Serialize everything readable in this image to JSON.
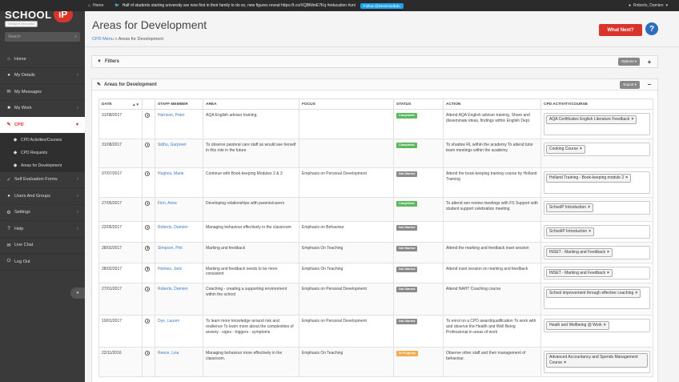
{
  "topbar": {
    "home": "Home",
    "tweet": "Half of students starting university are now first in their family to do so, new figures reveal https://t.co/XQBNlmE7Kq #education #uni",
    "follow": "Follow @DeveniodEdu",
    "user": "Roberts, Damien"
  },
  "logo": {
    "name": "SCHOOL",
    "ip": "iP",
    "tagline": "Intelligent Information"
  },
  "search": {
    "placeholder": "Search"
  },
  "nav": [
    {
      "label": "Home",
      "icon": "home-icon"
    },
    {
      "label": "My Details",
      "icon": "user-icon"
    },
    {
      "label": "My Messages",
      "icon": "envelope-icon"
    },
    {
      "label": "My Work",
      "icon": "briefcase-icon"
    }
  ],
  "cpd": {
    "label": "CPD",
    "sub": [
      {
        "label": "CPD Activities/Courses"
      },
      {
        "label": "CPD Requests"
      },
      {
        "label": "Areas for Development"
      }
    ]
  },
  "nav2": [
    {
      "label": "Self Evaluation Forms"
    },
    {
      "label": "Users And Groups"
    },
    {
      "label": "Settings"
    },
    {
      "label": "Help"
    },
    {
      "label": "Live Chat"
    },
    {
      "label": "Log Out"
    }
  ],
  "page": {
    "title": "Areas for Development",
    "crumb_link": "CPD Menu",
    "crumb_rest": " » Areas for Development",
    "what_next": "What Next?",
    "help": "?"
  },
  "filters": {
    "title": "Filters",
    "options_button": "Options ▾",
    "toggle": "+"
  },
  "areas": {
    "title": "Areas for Development",
    "export_button": "Export ▾",
    "toggle": "−"
  },
  "columns": [
    "DATE",
    "",
    "STAFF MEMBER",
    "AREA",
    "FOCUS",
    "STATUS",
    "ACTION",
    "CPD ACTIVITY/COURSE"
  ],
  "rows": [
    {
      "date": "31/08/2017",
      "staff": "Harrison, Peter",
      "area": "AQA English adviser training.",
      "focus": "",
      "status": "Completed",
      "action": "Attend AQA English adviser training. Share and disseminate ideas, findings within English Dept.",
      "course": "AQA Certificates English Literature Feedback"
    },
    {
      "date": "31/08/2017",
      "staff": "Sidhu, Gurpreet",
      "area": "To observe pastoral care staff as would see herself in this role in the future",
      "focus": "",
      "status": "Completed",
      "action": "To shadow RL within the academy To attend tutor team meetings within the academy",
      "course": "Cooking Course"
    },
    {
      "date": "07/07/2017",
      "staff": "Hughes, Marie",
      "area": "Continue with Book-keeping Modules 2 & 3",
      "focus": "Emphasis on Personal Development",
      "status": "Not Started",
      "action": "Attend the book-keeping training course by Holland Training",
      "course": "Holland Training - Book-keeping module 2"
    },
    {
      "date": "27/05/2017",
      "staff": "Finn, Anne",
      "area": "Developing relationships with parents/carers",
      "focus": "",
      "status": "Completed",
      "action": "To attend sen review meetings with FS Support with student support celebration meeting",
      "course": "SchoolP Introduction"
    },
    {
      "date": "22/05/2017",
      "staff": "Roberts, Damien",
      "area": "Managing behaviour effectively in the classroom",
      "focus": "Emphasis on Behaviour",
      "status": "Not Started",
      "action": "",
      "course": "SchooliP Introduction"
    },
    {
      "date": "28/02/2017",
      "staff": "Simpson, Phil",
      "area": "Marking and feedback",
      "focus": "Emphasis On Teaching",
      "status": "Not Started",
      "action": "Attend the marking and feedback inset session",
      "course": "INSET - Marking and Feedback"
    },
    {
      "date": "28/02/2017",
      "staff": "Holmes, Jack",
      "area": "Marking and feedback needs to be more consistent",
      "focus": "Emphasis On Teaching",
      "status": "Not Started",
      "action": "Attend inset session on marking and feedback",
      "course": "INSET - Marking and Feedback"
    },
    {
      "date": "27/01/2017",
      "staff": "Roberts, Damien",
      "area": "Coaching - creating a supporting environment within the school",
      "focus": "Emphasis on Personal Development",
      "status": "Not Started",
      "action": "Attend NAHT Coaching course",
      "course": "School improvement through effective coaching"
    },
    {
      "date": "10/01/2017",
      "staff": "Dye, Lauren",
      "area": "To learn more knowledge around risk and resilience To learn more about the complexities of anxiety - signs - triggers - symptoms",
      "focus": "Emphasis on Personal Development",
      "status": "Not Started",
      "action": "To enrol on a CPD award/qualification To work with and observe the Health and Well Being Professional in areas of work",
      "course": "Heath and Wellbeing @ Work"
    },
    {
      "date": "22/11/2016",
      "staff": "Reece, Lisa",
      "area": "Managing behaviour more effectively in the classroom.",
      "focus": "Emphasis On Teaching",
      "status": "In Progress",
      "action": "Observe other staff and their management of behaviour.",
      "course": "Advanced Accountancy and Spends Management Course"
    }
  ],
  "colors": {
    "accent": "#d9342b",
    "link": "#3a7bc8",
    "completed": "#5cb85c",
    "not_started": "#8a8a8a",
    "in_progress": "#f0ad4e"
  }
}
